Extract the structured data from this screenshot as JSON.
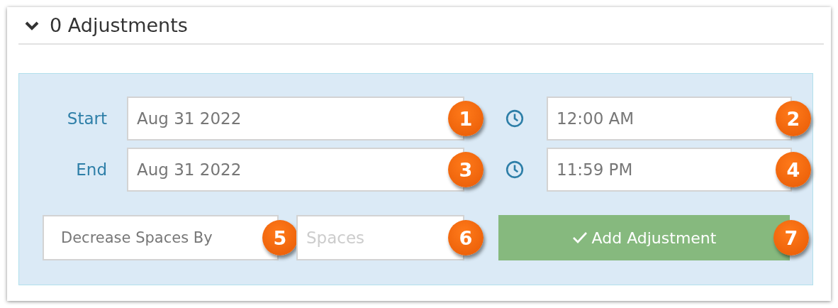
{
  "section": {
    "title": "0 Adjustments",
    "expanded": true
  },
  "rows": [
    {
      "label": "Start",
      "date": "Aug 31 2022",
      "date_marker": "1",
      "time": "12:00 AM",
      "time_marker": "2"
    },
    {
      "label": "End",
      "date": "Aug 31 2022",
      "date_marker": "3",
      "time": "11:59 PM",
      "time_marker": "4"
    }
  ],
  "adjustment_type": {
    "value": "Decrease Spaces By",
    "marker": "5"
  },
  "spaces": {
    "placeholder": "Spaces",
    "marker": "6"
  },
  "add_button": {
    "label": "Add Adjustment",
    "marker": "7"
  }
}
